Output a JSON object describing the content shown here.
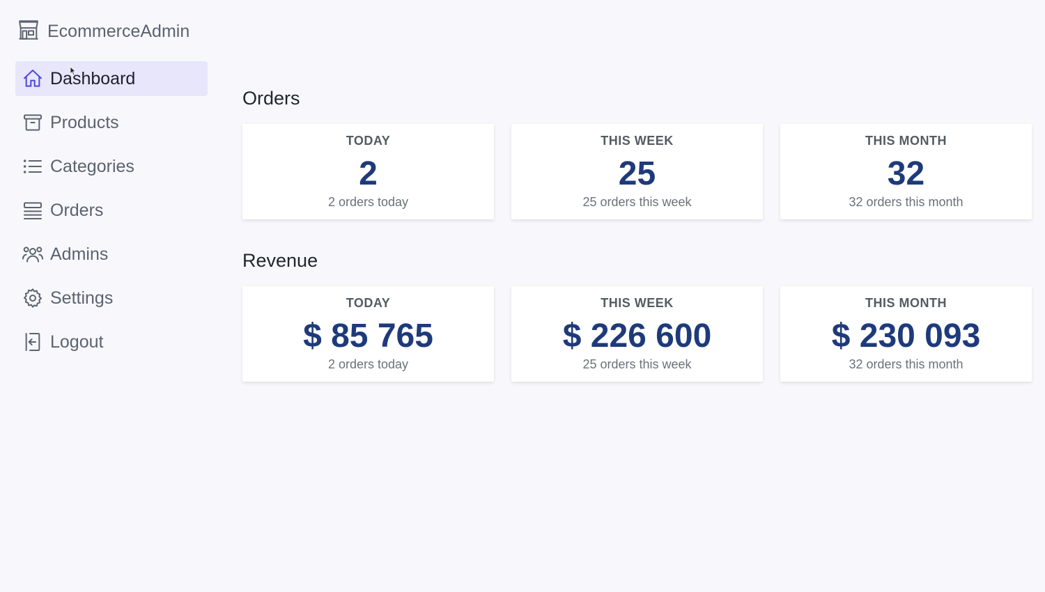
{
  "brand": {
    "name": "EcommerceAdmin",
    "icon": "store-icon"
  },
  "sidebar": {
    "items": [
      {
        "label": "Dashboard",
        "icon": "home-icon",
        "active": true
      },
      {
        "label": "Products",
        "icon": "archive-box-icon",
        "active": false
      },
      {
        "label": "Categories",
        "icon": "list-icon",
        "active": false
      },
      {
        "label": "Orders",
        "icon": "queue-list-icon",
        "active": false
      },
      {
        "label": "Admins",
        "icon": "users-icon",
        "active": false
      },
      {
        "label": "Settings",
        "icon": "gear-icon",
        "active": false
      },
      {
        "label": "Logout",
        "icon": "logout-icon",
        "active": false
      }
    ]
  },
  "orders": {
    "title": "Orders",
    "cards": [
      {
        "label": "TODAY",
        "value": "2",
        "sub": "2 orders today"
      },
      {
        "label": "THIS WEEK",
        "value": "25",
        "sub": "25 orders this week"
      },
      {
        "label": "THIS MONTH",
        "value": "32",
        "sub": "32 orders this month"
      }
    ]
  },
  "revenue": {
    "title": "Revenue",
    "cards": [
      {
        "label": "TODAY",
        "value": "$ 85 765",
        "sub": "2 orders today"
      },
      {
        "label": "THIS WEEK",
        "value": "$ 226 600",
        "sub": "25 orders this week"
      },
      {
        "label": "THIS MONTH",
        "value": "$ 230 093",
        "sub": "32 orders this month"
      }
    ]
  },
  "colors": {
    "accent": "#4a47d8",
    "active_bg": "#e7e6fb",
    "value": "#1e3a7b"
  }
}
